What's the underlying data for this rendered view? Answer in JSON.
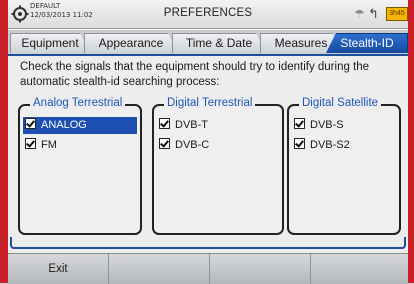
{
  "status": {
    "profile_name": "DEFAULT",
    "datetime": "12/03/2013 11:02",
    "title": "PREFERENCES",
    "battery_label": "3h45"
  },
  "tabs": [
    {
      "label": "Equipment",
      "active": false
    },
    {
      "label": "Appearance",
      "active": false
    },
    {
      "label": "Time & Date",
      "active": false
    },
    {
      "label": "Measures",
      "active": false
    },
    {
      "label": "Stealth-ID",
      "active": true
    }
  ],
  "content": {
    "instructions": "Check the signals that the equipment should try to identify during the automatic stealth-id searching process:"
  },
  "groups": [
    {
      "title": "Analog Terrestrial",
      "items": [
        {
          "label": "ANALOG",
          "checked": true,
          "selected": true
        },
        {
          "label": "FM",
          "checked": true,
          "selected": false
        }
      ]
    },
    {
      "title": "Digital Terrestrial",
      "items": [
        {
          "label": "DVB-T",
          "checked": true,
          "selected": false
        },
        {
          "label": "DVB-C",
          "checked": true,
          "selected": false
        }
      ]
    },
    {
      "title": "Digital Satellite",
      "items": [
        {
          "label": "DVB-S",
          "checked": true,
          "selected": false
        },
        {
          "label": "DVB-S2",
          "checked": true,
          "selected": false
        }
      ]
    }
  ],
  "softkeys": [
    {
      "label": "Exit"
    },
    {
      "label": ""
    },
    {
      "label": ""
    },
    {
      "label": ""
    }
  ],
  "colors": {
    "accent": "#1d4fb0",
    "frame_red": "#c9202a",
    "group_title": "#1e57b8",
    "battery": "#f4b400"
  }
}
